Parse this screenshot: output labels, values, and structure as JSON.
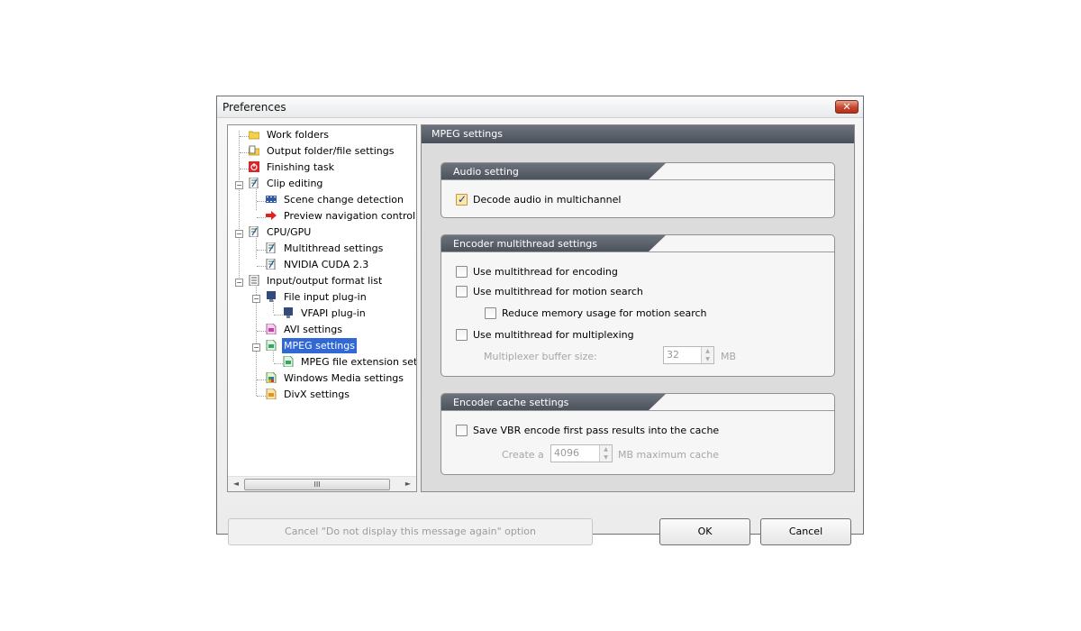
{
  "window": {
    "title": "Preferences",
    "close": "✕"
  },
  "tree": {
    "items": [
      "Work folders",
      "Output folder/file settings",
      "Finishing task",
      "Clip editing",
      "Scene change detection",
      "Preview navigation control",
      "CPU/GPU",
      "Multithread settings",
      "NVIDIA CUDA 2.3",
      "Input/output format list",
      "File input plug-in",
      "VFAPI plug-in",
      "AVI settings",
      "MPEG settings",
      "MPEG file extension settings",
      "Windows Media settings",
      "DivX settings"
    ],
    "toggle_collapse": "−",
    "scroll_left": "◄",
    "scroll_right": "►",
    "scroll_grip": "III"
  },
  "panel": {
    "title": "MPEG settings",
    "audio": {
      "title": "Audio setting",
      "decode_multichannel": "Decode audio in multichannel"
    },
    "encoder_mt": {
      "title": "Encoder multithread settings",
      "use_encoding": "Use multithread for encoding",
      "use_motion": "Use multithread for motion search",
      "reduce_memory": "Reduce memory usage for motion search",
      "use_multiplexing": "Use multithread for multiplexing",
      "buffer_label": "Multiplexer buffer size:",
      "buffer_value": "32",
      "buffer_unit": "MB"
    },
    "cache": {
      "title": "Encoder cache settings",
      "save_vbr": "Save VBR encode first pass results into the cache",
      "create_label": "Create a",
      "cache_value": "4096",
      "cache_unit": "MB maximum cache"
    }
  },
  "buttons": {
    "cancel_message": "Cancel \"Do not display this message again\" option",
    "ok": "OK",
    "cancel": "Cancel"
  },
  "colors": {
    "selected": "#3168d5",
    "header": "#50565f"
  }
}
